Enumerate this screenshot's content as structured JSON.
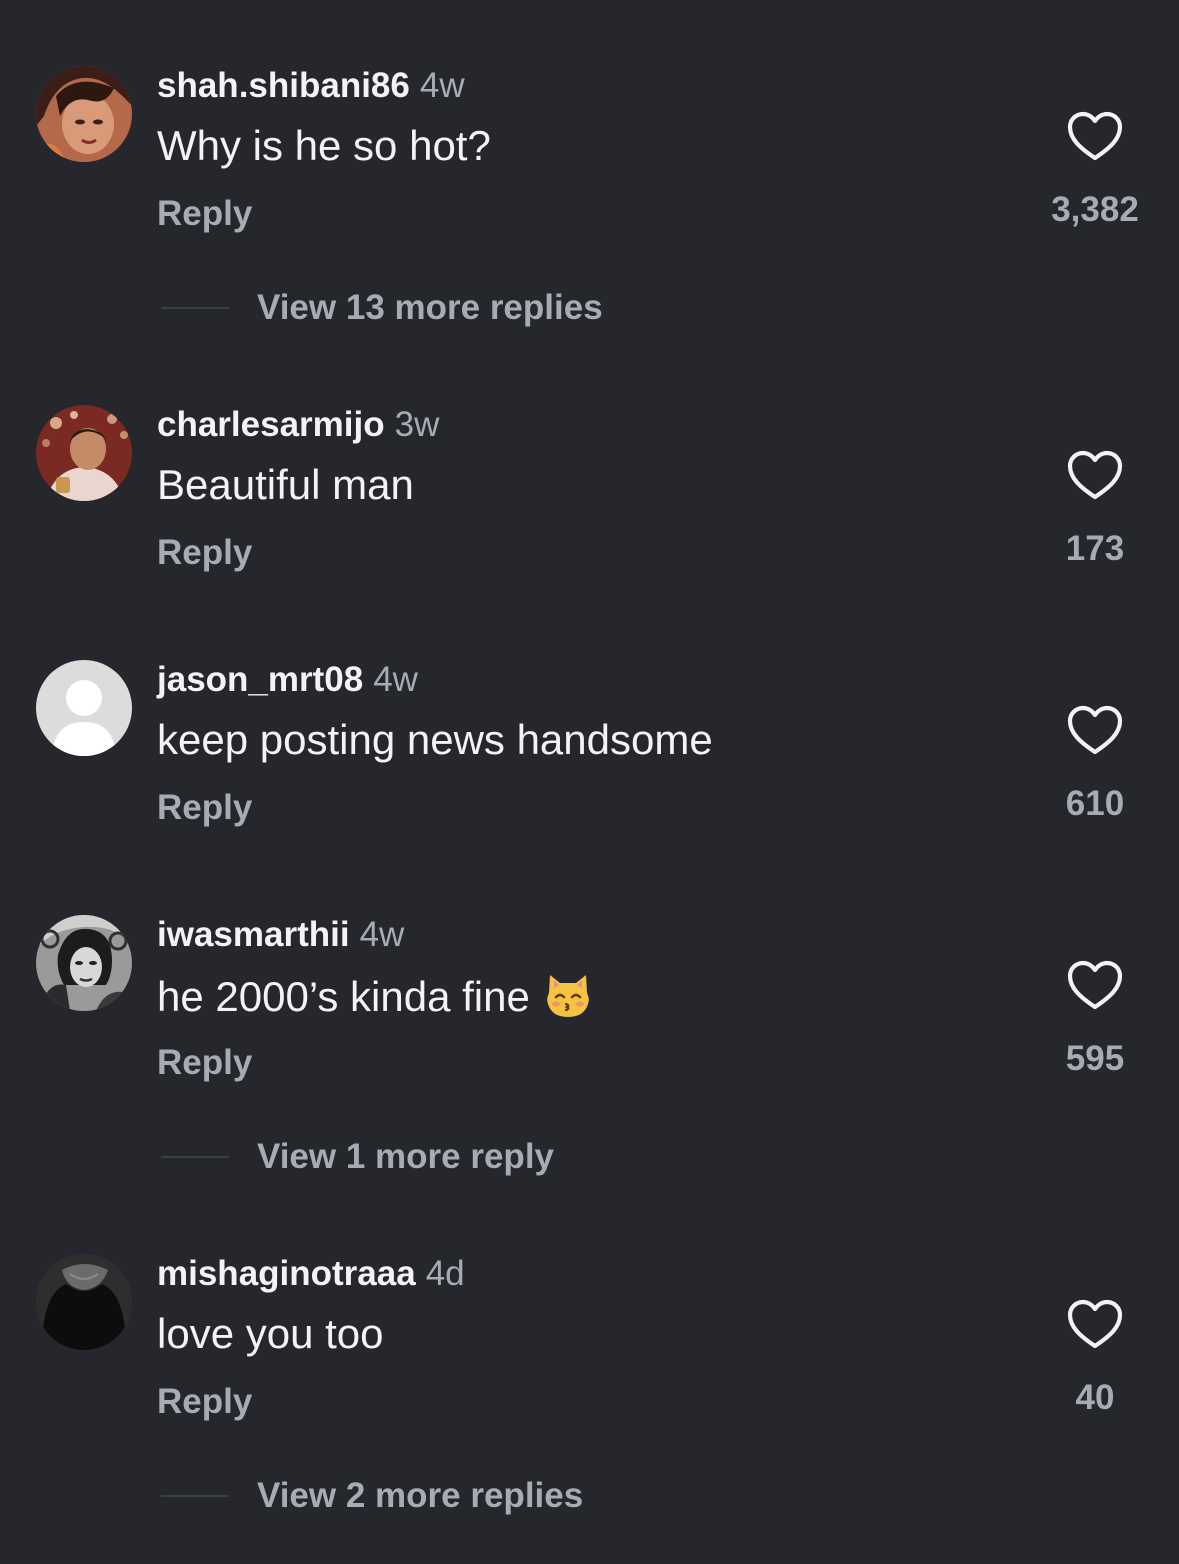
{
  "comments": [
    {
      "username": "shah.shibani86",
      "time": "4w",
      "text": "Why is he so hot?",
      "reply_label": "Reply",
      "likes": "3,382",
      "view_more": "View 13 more replies"
    },
    {
      "username": "charlesarmijo",
      "time": "3w",
      "text": "Beautiful man",
      "reply_label": "Reply",
      "likes": "173"
    },
    {
      "username": "jason_mrt08",
      "time": "4w",
      "text": "keep posting news handsome",
      "reply_label": "Reply",
      "likes": "610"
    },
    {
      "username": "iwasmarthii",
      "time": "4w",
      "text": "he 2000’s kinda fine",
      "emoji": "kissing-cat-face",
      "reply_label": "Reply",
      "likes": "595",
      "view_more": "View 1 more reply"
    },
    {
      "username": "mishaginotraaa",
      "time": "4d",
      "text": "love you too",
      "reply_label": "Reply",
      "likes": "40",
      "view_more": "View 2 more replies"
    }
  ],
  "colors": {
    "background": "#25272c",
    "primary_text": "#f2f3f5",
    "secondary_text": "#a7abb2",
    "emoji_yellow": "#f6c242"
  },
  "icons": {
    "like": "heart-outline-icon",
    "default_avatar": "person-silhouette-icon"
  }
}
